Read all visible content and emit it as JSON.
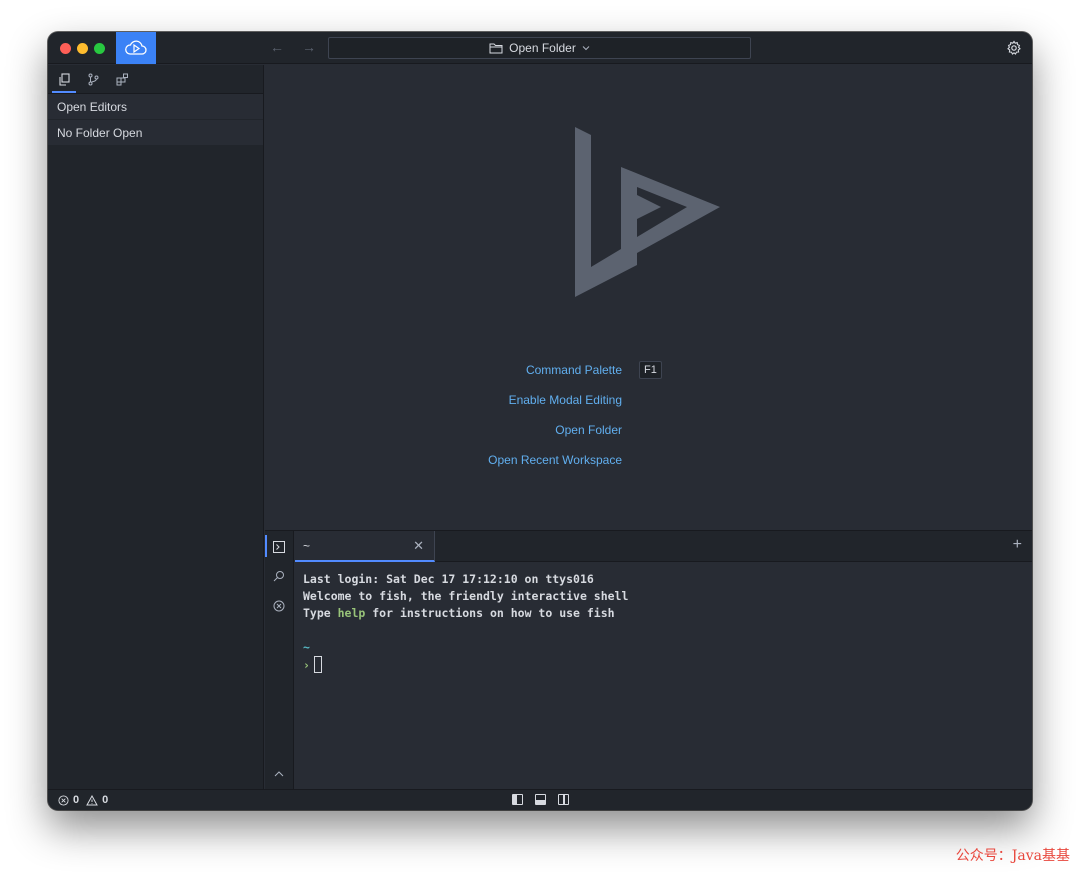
{
  "titlebar": {
    "open_folder_label": "Open Folder",
    "icons": [
      "cloud-app-icon",
      "back-arrow-icon",
      "forward-arrow-icon",
      "folder-icon",
      "chevron-down-icon",
      "gear-icon"
    ]
  },
  "sidebar": {
    "tabs": [
      "files-icon",
      "source-control-icon",
      "extensions-icon"
    ],
    "sections": [
      {
        "label": "Open Editors"
      },
      {
        "label": "No Folder Open"
      }
    ]
  },
  "welcome": {
    "items": [
      {
        "label": "Command Palette",
        "shortcut": "F1"
      },
      {
        "label": "Enable Modal Editing"
      },
      {
        "label": "Open Folder"
      },
      {
        "label": "Open Recent Workspace"
      }
    ]
  },
  "panel": {
    "tab_title": "~",
    "terminal": {
      "line1": "Last login: Sat Dec 17 17:12:10 on ttys016",
      "line2": "Welcome to fish, the friendly interactive shell",
      "line3_pre": "Type ",
      "line3_cmd": "help",
      "line3_post": " for instructions on how to use fish",
      "cwd": "~",
      "prompt": "›"
    }
  },
  "statusbar": {
    "errors": "0",
    "warnings": "0"
  },
  "watermark": "公众号：Java基基",
  "colors": {
    "accent": "#528bff",
    "link": "#61afef",
    "background": "#282c34",
    "sidebar": "#21252b"
  }
}
